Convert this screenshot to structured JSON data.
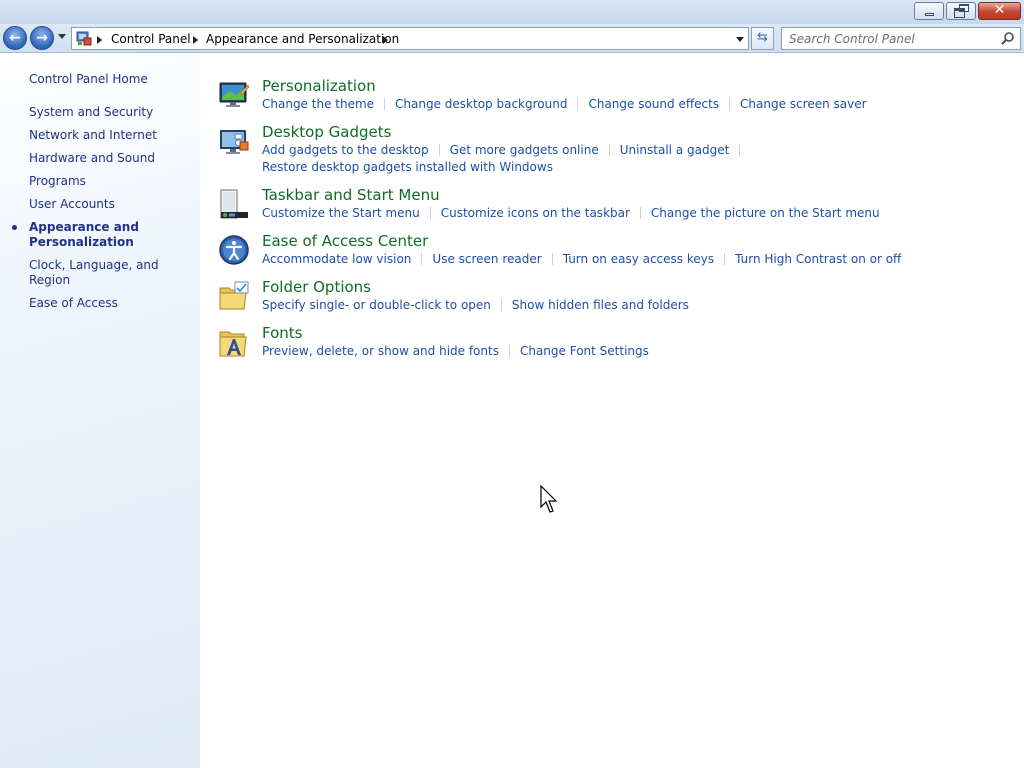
{
  "window": {
    "caption_buttons": [
      "minimize-icon",
      "maximize-icon",
      "close-icon"
    ]
  },
  "nav": {
    "breadcrumbs": [
      "Control Panel",
      "Appearance and Personalization"
    ],
    "search_placeholder": "Search Control Panel"
  },
  "sidebar": {
    "home": "Control Panel Home",
    "items": [
      {
        "label": "System and Security"
      },
      {
        "label": "Network and Internet"
      },
      {
        "label": "Hardware and Sound"
      },
      {
        "label": "Programs"
      },
      {
        "label": "User Accounts"
      },
      {
        "label": "Appearance and Personalization",
        "current": true
      },
      {
        "label": "Clock, Language, and Region"
      },
      {
        "label": "Ease of Access"
      }
    ]
  },
  "categories": [
    {
      "title": "Personalization",
      "icon": "personalization-icon",
      "lines": [
        [
          "Change the theme",
          "Change desktop background",
          "Change sound effects",
          "Change screen saver"
        ]
      ]
    },
    {
      "title": "Desktop Gadgets",
      "icon": "gadgets-icon",
      "lines": [
        [
          "Add gadgets to the desktop",
          "Get more gadgets online",
          "Uninstall a gadget"
        ],
        [
          "Restore desktop gadgets installed with Windows"
        ]
      ]
    },
    {
      "title": "Taskbar and Start Menu",
      "icon": "taskbar-icon",
      "lines": [
        [
          "Customize the Start menu",
          "Customize icons on the taskbar",
          "Change the picture on the Start menu"
        ]
      ]
    },
    {
      "title": "Ease of Access Center",
      "icon": "ease-of-access-icon",
      "lines": [
        [
          "Accommodate low vision",
          "Use screen reader",
          "Turn on easy access keys",
          "Turn High Contrast on or off"
        ]
      ]
    },
    {
      "title": "Folder Options",
      "icon": "folder-options-icon",
      "lines": [
        [
          "Specify single- or double-click to open",
          "Show hidden files and folders"
        ]
      ]
    },
    {
      "title": "Fonts",
      "icon": "fonts-icon",
      "lines": [
        [
          "Preview, delete, or show and hide fonts",
          "Change Font Settings"
        ]
      ]
    }
  ],
  "colors": {
    "link": "#1e4ea6",
    "category_title": "#0f6c25",
    "sidebar_link": "#1e3287"
  }
}
